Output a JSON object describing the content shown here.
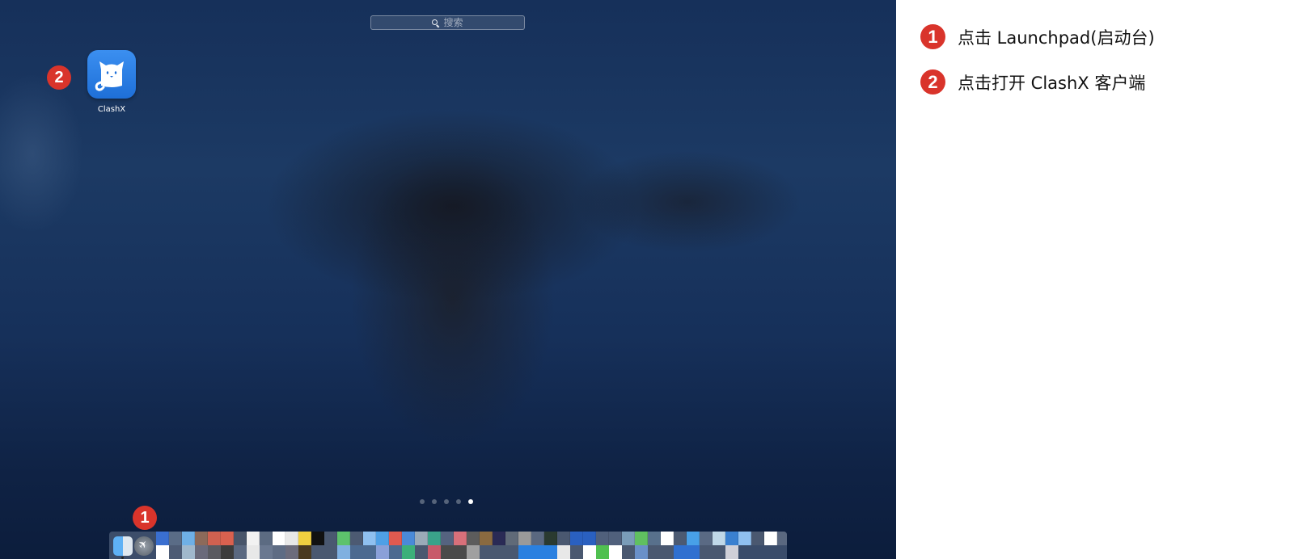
{
  "launchpad": {
    "search": {
      "placeholder": "搜索",
      "icon": "search-icon"
    },
    "apps": [
      {
        "label": "ClashX",
        "icon": "clashx-cat-icon"
      }
    ],
    "page_dots": {
      "count": 5,
      "active_index": 4
    },
    "callouts": {
      "app_badge": "2",
      "dock_badge": "1"
    },
    "dock": {
      "items": [
        {
          "name": "Finder",
          "icon": "finder-icon"
        },
        {
          "name": "Launchpad",
          "icon": "launchpad-rocket-icon"
        }
      ]
    }
  },
  "instructions": {
    "steps": [
      {
        "number": "1",
        "text": "点击 Launchpad(启动台)"
      },
      {
        "number": "2",
        "text": "点击打开 ClashX 客户端"
      }
    ]
  },
  "colors": {
    "badge": "#d9342b",
    "accent_blue": "#2f86ec",
    "background_dark": "#16305a"
  }
}
